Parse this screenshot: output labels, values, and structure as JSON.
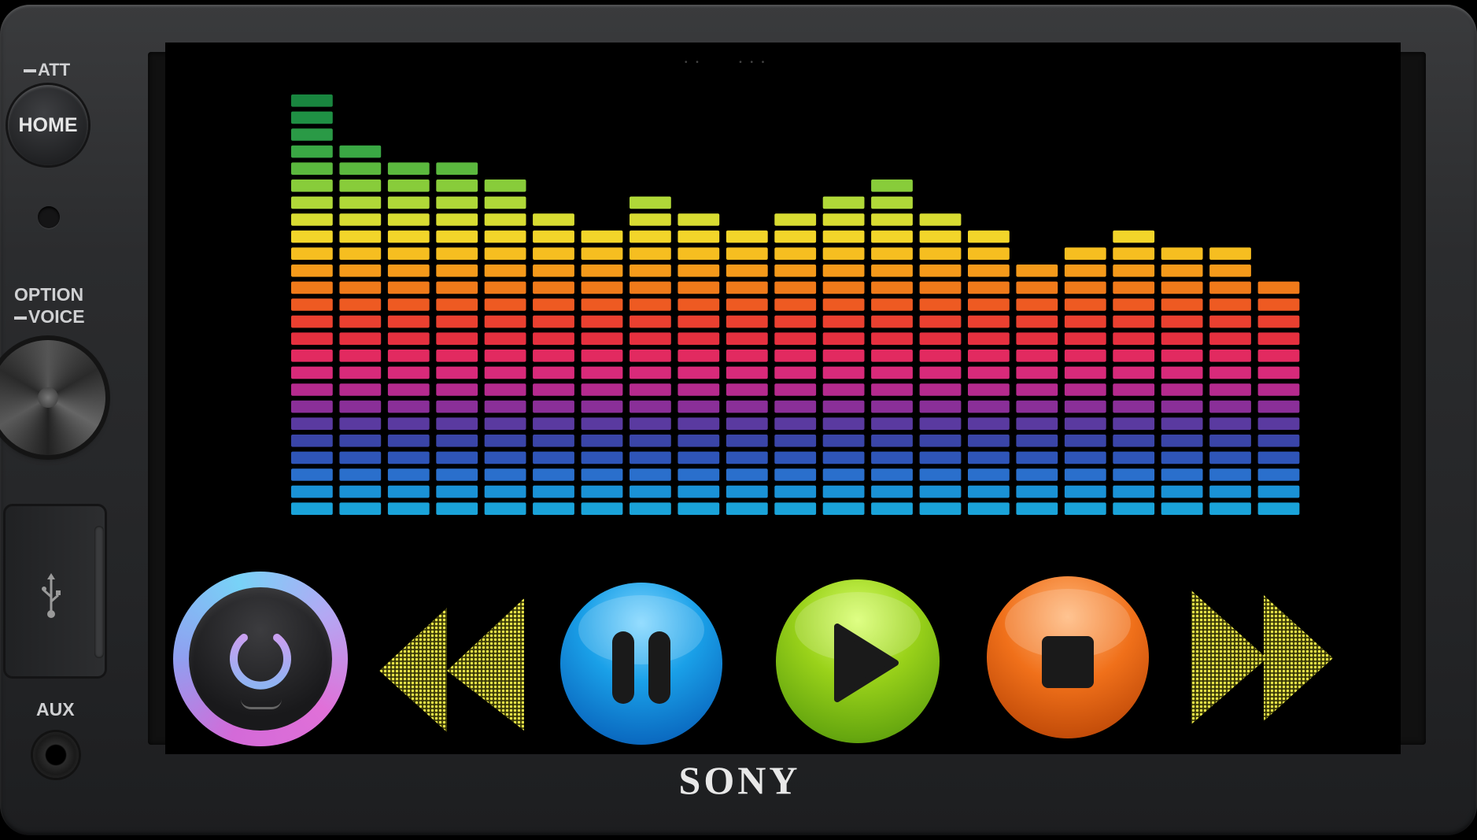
{
  "device": {
    "brand": "SONY",
    "side_labels": {
      "att": "ATT",
      "home": "HOME",
      "option": "OPTION",
      "voice": "VOICE",
      "aux": "AUX"
    },
    "icons": {
      "usb": "usb-icon"
    }
  },
  "equalizer": {
    "levels": [
      25,
      22,
      21,
      21,
      20,
      18,
      17,
      19,
      18,
      17,
      18,
      19,
      20,
      18,
      17,
      15,
      16,
      17,
      16,
      16,
      14
    ],
    "max_segments": 25,
    "colors": [
      "#1aa3d9",
      "#1a92d6",
      "#2a6fcc",
      "#2f55b8",
      "#3a45a8",
      "#5a3aa0",
      "#8a2f98",
      "#b52a8e",
      "#d82a7a",
      "#e22a60",
      "#e6303f",
      "#ea4030",
      "#ee5a22",
      "#f07a1a",
      "#f49a1a",
      "#f6be20",
      "#f2d52a",
      "#d8dc32",
      "#b0d838",
      "#88cc3a",
      "#5bb83e",
      "#3aa844",
      "#2a9a46",
      "#1f9044",
      "#19863f"
    ]
  },
  "controls": {
    "power": "power-icon",
    "rewind": "rewind-icon",
    "pause": "pause-icon",
    "play": "play-icon",
    "stop": "stop-icon",
    "fast_forward": "fast-forward-icon"
  }
}
